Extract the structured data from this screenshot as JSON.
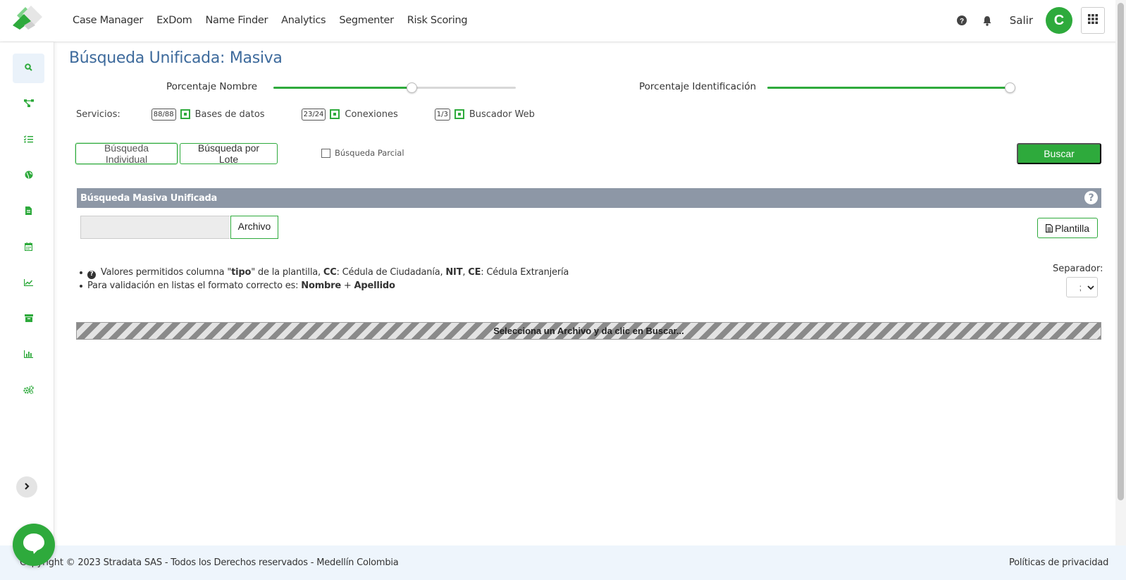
{
  "colors": {
    "accent": "#2eaa3c",
    "title": "#3d6a9c",
    "panel_header": "#8d97a6"
  },
  "nav": {
    "items": [
      "Case Manager",
      "ExDom",
      "Name Finder",
      "Analytics",
      "Segmenter",
      "Risk Scoring"
    ]
  },
  "topbar": {
    "salir": "Salir",
    "avatar_initial": "C",
    "help_icon": "question-circle-icon",
    "bell_icon": "bell-icon",
    "apps_icon": "grid-icon"
  },
  "sidebar": {
    "items": [
      "search-icon",
      "network-icon",
      "list-check-icon",
      "globe-icon",
      "document-icon",
      "calendar-icon",
      "line-chart-icon",
      "archive-icon",
      "bar-chart-icon",
      "cogs-icon"
    ],
    "active": 0
  },
  "page": {
    "title": "Búsqueda Unificada: Masiva"
  },
  "sliders": {
    "nombre": {
      "label": "Porcentaje Nombre",
      "value_percent": 57
    },
    "identificacion": {
      "label": "Porcentaje Identificación",
      "value_percent": 100
    }
  },
  "services": {
    "label": "Servicios:",
    "items": [
      {
        "count": "88/88",
        "name": "Bases de datos",
        "checked": true
      },
      {
        "count": "23/24",
        "name": "Conexiones",
        "checked": true
      },
      {
        "count": "1/3",
        "name": "Buscador Web",
        "checked": true
      }
    ]
  },
  "search_modes": {
    "individual": "Búsqueda Individual",
    "lote": "Búsqueda por Lote",
    "active": "individual"
  },
  "partial": {
    "label": "Búsqueda Parcial",
    "checked": false
  },
  "buscar": "Buscar",
  "panel": {
    "title": "Búsqueda Masiva Unificada",
    "help": "?"
  },
  "file": {
    "button": "Archivo",
    "value": ""
  },
  "plantilla": "Plantilla",
  "notes": {
    "line1": {
      "pre": " Valores permitidos columna \"",
      "tipo": "tipo",
      "mid": "\" de la plantilla, ",
      "cc": "CC",
      "cc_desc": ": Cédula de Ciudadanía, ",
      "nit": "NIT",
      "sep": ", ",
      "ce": "CE",
      "ce_desc": ": Cédula Extranjería"
    },
    "line2": {
      "pre": "Para validación en listas el formato correcto es: ",
      "nombre": "Nombre",
      "plus": " + ",
      "apellido": "Apellido"
    }
  },
  "separator": {
    "label": "Separador:",
    "value": ";"
  },
  "progress": {
    "text": "Selecciona un Archivo y da clic en Buscar..."
  },
  "footer": {
    "copyright": "Copyright © 2023 Stradata SAS - Todos los Derechos reservados - Medellín Colombia",
    "privacy": "Políticas de privacidad"
  }
}
